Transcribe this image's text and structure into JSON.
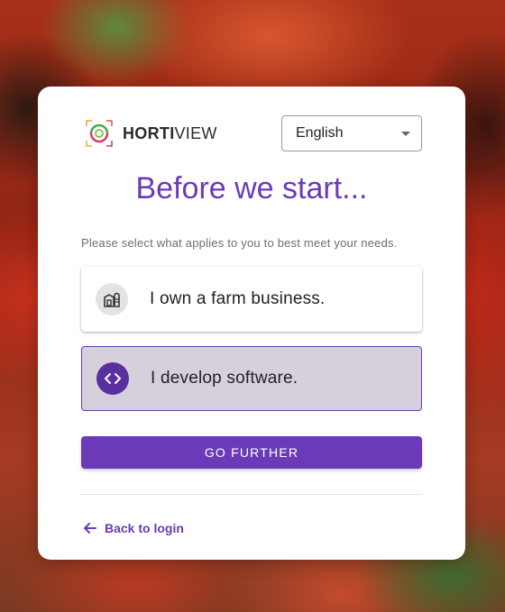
{
  "brand": {
    "name_bold": "HORTI",
    "name_regular": "VIEW",
    "logo_icon": "hortiview-logo-icon"
  },
  "language_select": {
    "value": "English"
  },
  "heading": {
    "title": "Before we start...",
    "subtitle": "Please select what applies to you to best meet your needs."
  },
  "options": [
    {
      "label": "I own a farm business.",
      "icon": "farm-building-icon",
      "selected": false
    },
    {
      "label": "I develop software.",
      "icon": "code-icon",
      "selected": true
    }
  ],
  "actions": {
    "go_further": "GO FURTHER",
    "back_to_login": "Back to login"
  },
  "colors": {
    "accent": "#6a3ab8",
    "selected_bg": "#d6d0dc"
  }
}
